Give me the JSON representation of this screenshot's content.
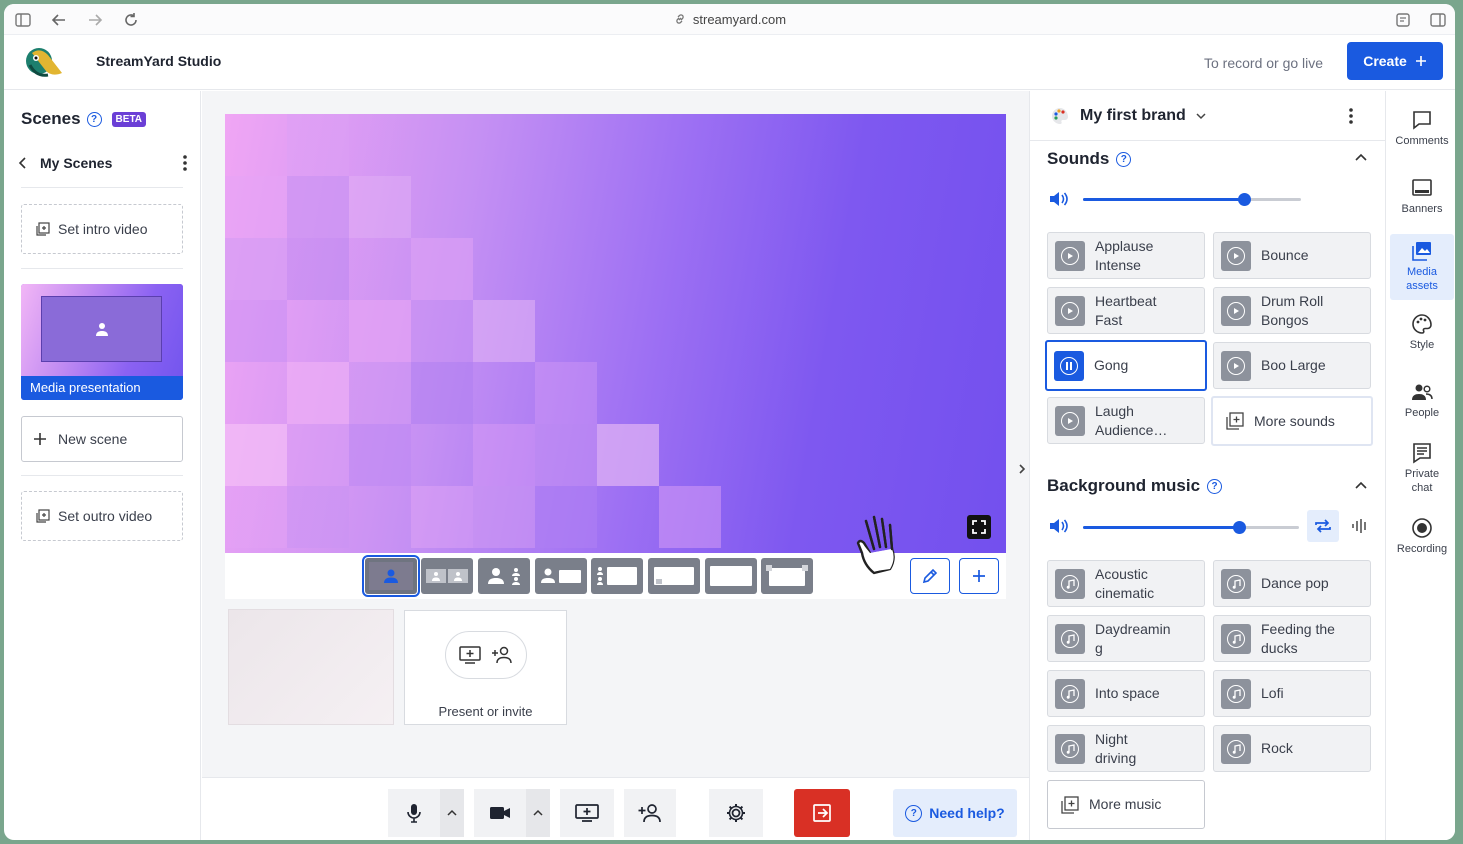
{
  "browser": {
    "url": "streamyard.com"
  },
  "header": {
    "title": "StreamYard Studio",
    "hint": "To record or go live",
    "create_label": "Create"
  },
  "left": {
    "scenes_title": "Scenes",
    "beta_badge": "BETA",
    "my_scenes": "My Scenes",
    "intro_label": "Set intro video",
    "scene_card_label": "Media presentation",
    "new_scene_label": "New scene",
    "outro_label": "Set outro video"
  },
  "center": {
    "present_label": "Present or invite",
    "need_help": "Need help?"
  },
  "right": {
    "brand": "My first brand",
    "sounds_title": "Sounds",
    "sounds_volume": 0.74,
    "sounds": [
      {
        "l1": "Applause",
        "l2": "Intense"
      },
      {
        "l1": "Bounce",
        "l2": ""
      },
      {
        "l1": "Heartbeat",
        "l2": "Fast"
      },
      {
        "l1": "Drum Roll",
        "l2": "Bongos"
      },
      {
        "l1": "Gong",
        "l2": ""
      },
      {
        "l1": "Boo Large",
        "l2": ""
      },
      {
        "l1": "Laugh",
        "l2": "Audience…"
      }
    ],
    "more_sounds": "More sounds",
    "music_title": "Background music",
    "music_volume": 0.72,
    "music": [
      {
        "l1": "Acoustic",
        "l2": "cinematic"
      },
      {
        "l1": "Dance pop",
        "l2": ""
      },
      {
        "l1": "Daydreamin",
        "l2": "g"
      },
      {
        "l1": "Feeding the",
        "l2": "ducks"
      },
      {
        "l1": "Into space",
        "l2": ""
      },
      {
        "l1": "Lofi",
        "l2": ""
      },
      {
        "l1": "Night",
        "l2": "driving"
      },
      {
        "l1": "Rock",
        "l2": ""
      }
    ],
    "more_music": "More music"
  },
  "sidebar": {
    "comments": "Comments",
    "banners": "Banners",
    "media_1": "Media",
    "media_2": "assets",
    "style": "Style",
    "people": "People",
    "private_1": "Private",
    "private_2": "chat",
    "recording": "Recording"
  },
  "colors": {
    "accent": "#1a5ae0",
    "leave": "#d93025",
    "beta": "#6b3fd6"
  }
}
